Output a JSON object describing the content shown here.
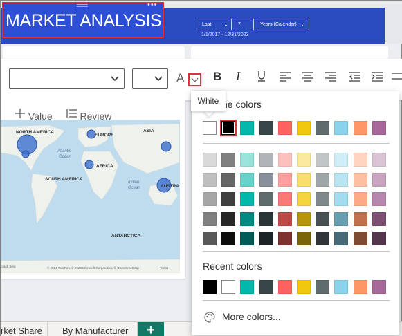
{
  "report": {
    "title": "MARKET ANALYSIS",
    "filters": [
      {
        "value": "Last"
      },
      {
        "value": "7"
      },
      {
        "value": "Years (Calendar)"
      }
    ],
    "date_range": "1/1/2017 - 12/31/2023"
  },
  "toolbar": {
    "font_family_value": "",
    "font_size_value": "",
    "font_color_letter": "A",
    "buttons": [
      "bold",
      "italic",
      "underline",
      "align-left",
      "align-center",
      "align-right",
      "decrease-indent",
      "increase-indent",
      "more"
    ]
  },
  "visual": {
    "add_value_label": "Value",
    "review_label": "Review",
    "map_labels": {
      "north_america": "NORTH AMERICA",
      "europe": "EUROPE",
      "asia": "ASIA",
      "atlantic": "Atlantic",
      "ocean1": "Ocean",
      "africa": "AFRICA",
      "south_america": "SOUTH AMERICA",
      "indian": "Indian",
      "ocean2": "Ocean",
      "australia": "AUSTRA",
      "antarctica": "ANTARCTICA",
      "ms_bing": "rosoft Bing",
      "copyright": "© 2024 TomTom, © 2024 Microsoft Corporation, © OpenStreetMap",
      "terms": "Terms"
    }
  },
  "tabs": [
    {
      "label": "rket Share"
    },
    {
      "label": "By Manufacturer"
    }
  ],
  "tooltip": {
    "text": "White"
  },
  "picker": {
    "theme_heading": "Theme colors",
    "recent_heading": "Recent colors",
    "more_colors_label": "More colors...",
    "selected_color": "#000000",
    "theme_row": [
      "#FFFFFF",
      "#000000",
      "#01B8AA",
      "#374649",
      "#FD625E",
      "#F2C80F",
      "#5F6B6D",
      "#8AD4EB",
      "#FE9666",
      "#A66999"
    ],
    "shade_rows": [
      [
        "#D9D9D9",
        "#808080",
        "#99E3DD",
        "#AFB5B6",
        "#FEC0BF",
        "#FAE99F",
        "#BFC4C5",
        "#D0EEF7",
        "#FFD5C2",
        "#DBC3D6"
      ],
      [
        "#BFBFBF",
        "#666666",
        "#67D4CC",
        "#87909B",
        "#FEA19E",
        "#F7DE6F",
        "#9FA6A7",
        "#B9E5F3",
        "#FEC0A3",
        "#CAA5C2"
      ],
      [
        "#A6A6A6",
        "#404040",
        "#01B8AA",
        "#5F6B6D",
        "#FD7976",
        "#F5D33F",
        "#7F898A",
        "#A1DDEF",
        "#FEAB85",
        "#B887AD"
      ],
      [
        "#808080",
        "#262626",
        "#018A80",
        "#293537",
        "#BE4A47",
        "#B6960B",
        "#475052",
        "#689FB0",
        "#BF714D",
        "#7D4F73"
      ],
      [
        "#595959",
        "#0D0D0D",
        "#015C55",
        "#1C2325",
        "#7F312F",
        "#796408",
        "#303637",
        "#456A76",
        "#7F4B33",
        "#53354C"
      ]
    ],
    "recent_row": [
      "#000000",
      "#FFFFFF",
      "#01B8AA",
      "#374649",
      "#FD625E",
      "#F2C80F",
      "#5F6B6D",
      "#8AD4EB",
      "#FE9666",
      "#A66999"
    ]
  }
}
